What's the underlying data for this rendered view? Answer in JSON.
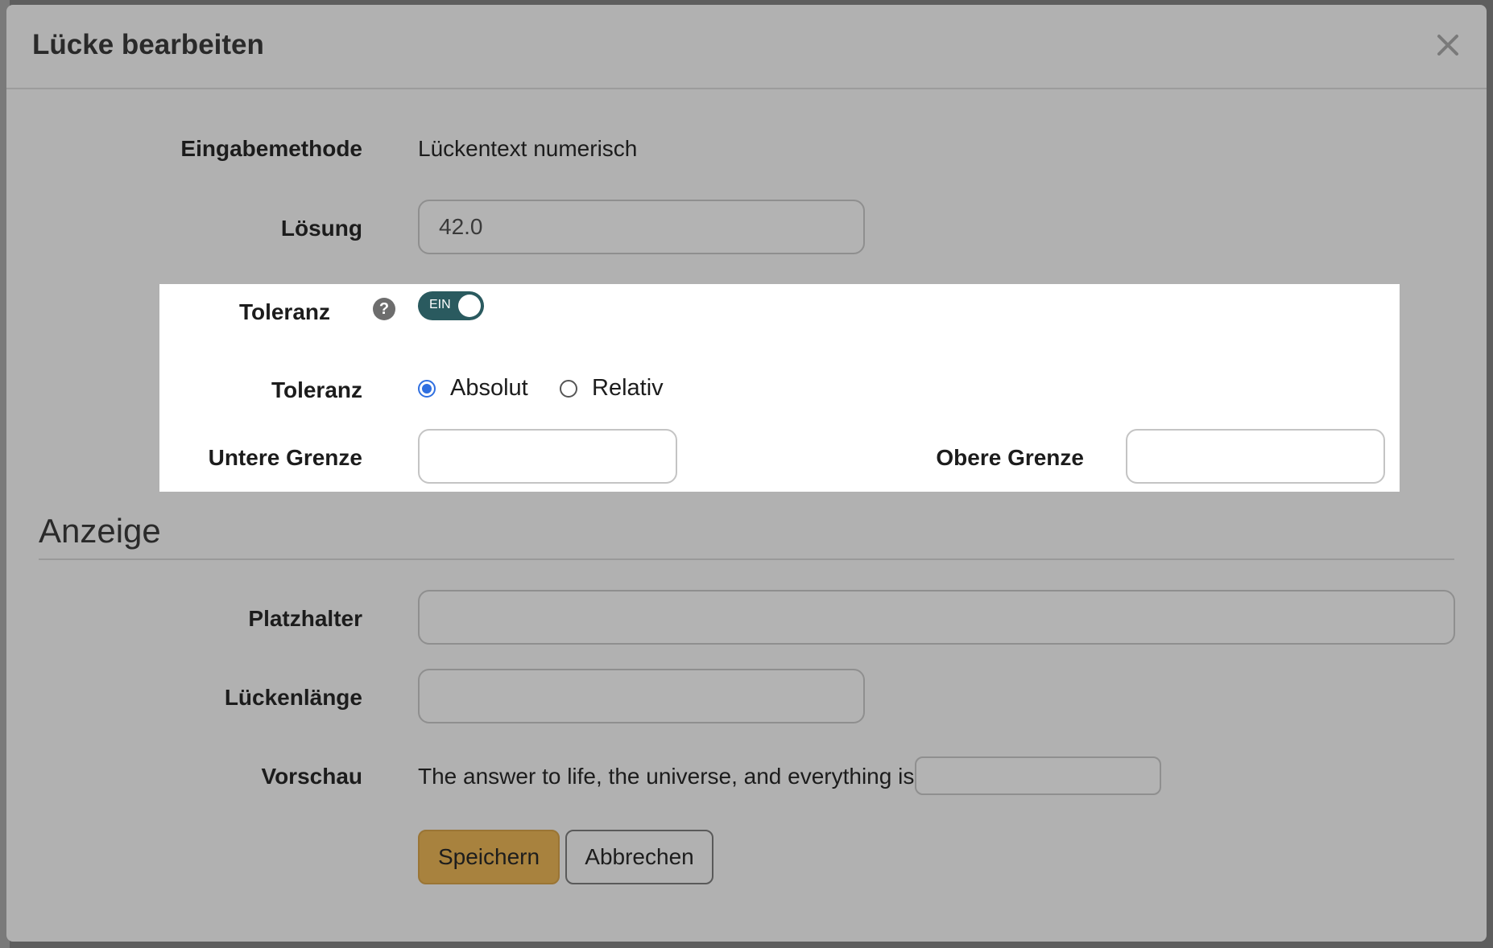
{
  "modal": {
    "title": "Lücke bearbeiten"
  },
  "fields": {
    "input_method": {
      "label": "Eingabemethode",
      "value": "Lückentext numerisch"
    },
    "solution": {
      "label": "Lösung",
      "value": "42.0"
    },
    "tolerance_toggle": {
      "label": "Toleranz",
      "state_label": "EIN",
      "on": true
    },
    "tolerance_type": {
      "label": "Toleranz",
      "options": [
        {
          "label": "Absolut",
          "checked": true
        },
        {
          "label": "Relativ",
          "checked": false
        }
      ]
    },
    "lower_bound": {
      "label": "Untere Grenze",
      "value": ""
    },
    "upper_bound": {
      "label": "Obere Grenze",
      "value": ""
    }
  },
  "display_section": {
    "title": "Anzeige",
    "placeholder": {
      "label": "Platzhalter",
      "value": ""
    },
    "gap_length": {
      "label": "Lückenlänge",
      "value": ""
    },
    "preview": {
      "label": "Vorschau",
      "text": "The answer to life, the universe, and everything is"
    }
  },
  "buttons": {
    "save": "Speichern",
    "cancel": "Abbrechen"
  },
  "icons": {
    "close": "close-icon",
    "help": "help-icon"
  },
  "colors": {
    "toggle_on": "#2a5a5f",
    "primary_button": "#a8823e",
    "radio_checked": "#2f6fe0"
  }
}
